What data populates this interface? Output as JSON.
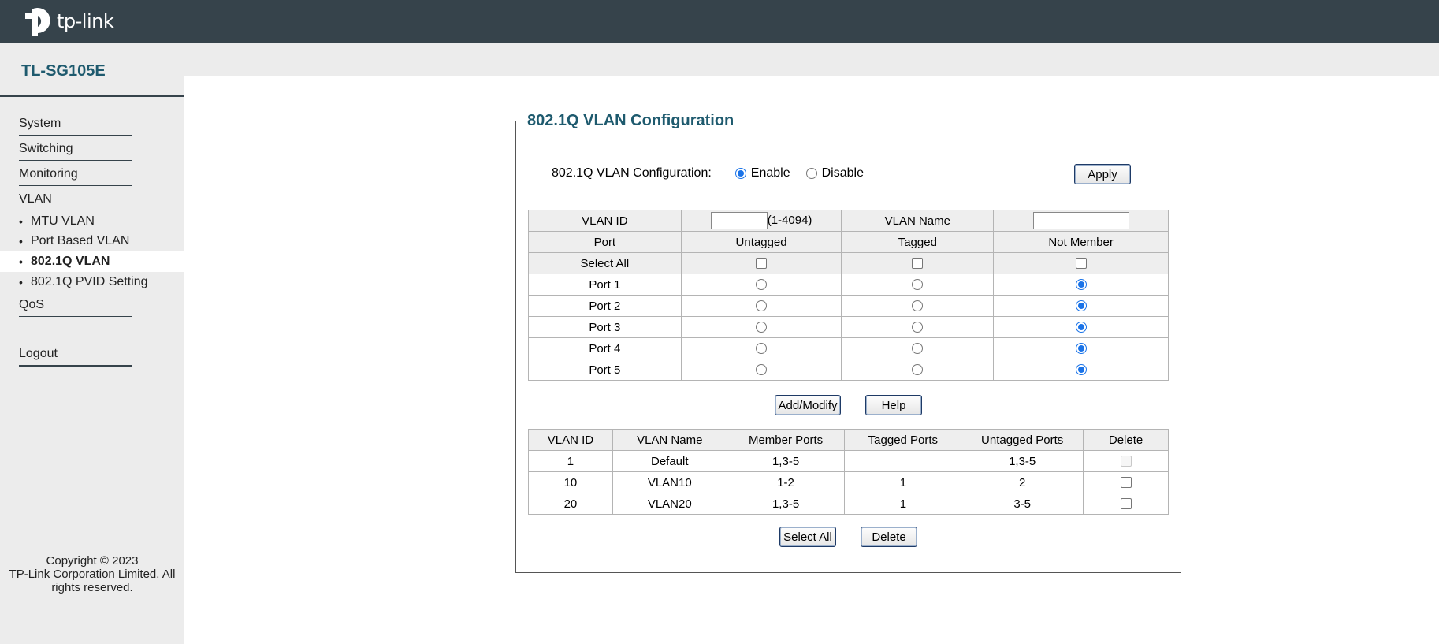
{
  "brand": {
    "logo_text": "tp-link",
    "model": "TL-SG105E"
  },
  "sidebar": {
    "system": "System",
    "switching": "Switching",
    "monitoring": "Monitoring",
    "vlan": "VLAN",
    "vlan_items": [
      "MTU VLAN",
      "Port Based VLAN",
      "802.1Q VLAN",
      "802.1Q PVID Setting"
    ],
    "active_item": "802.1Q VLAN",
    "qos": "QoS",
    "logout": "Logout",
    "copyright_line1": "Copyright © 2023",
    "copyright_line2": "TP-Link Corporation Limited. All",
    "copyright_line3": "rights reserved."
  },
  "panel": {
    "title": "802.1Q VLAN Configuration",
    "config_label": "802.1Q VLAN Configuration:",
    "enable_label": "Enable",
    "disable_label": "Disable",
    "selected_mode": "Enable",
    "apply_label": "Apply",
    "vlan_id_label": "VLAN ID",
    "vlan_id_value": "",
    "vlan_id_range": "(1-4094)",
    "vlan_name_label": "VLAN Name",
    "vlan_name_value": "",
    "port_header": "Port",
    "untagged_header": "Untagged",
    "tagged_header": "Tagged",
    "not_member_header": "Not Member",
    "select_all_label": "Select All",
    "ports": [
      {
        "name": "Port 1",
        "membership": "Not Member"
      },
      {
        "name": "Port 2",
        "membership": "Not Member"
      },
      {
        "name": "Port 3",
        "membership": "Not Member"
      },
      {
        "name": "Port 4",
        "membership": "Not Member"
      },
      {
        "name": "Port 5",
        "membership": "Not Member"
      }
    ],
    "add_modify_label": "Add/Modify",
    "help_label": "Help",
    "vlan_table": {
      "headers": [
        "VLAN ID",
        "VLAN Name",
        "Member Ports",
        "Tagged Ports",
        "Untagged Ports",
        "Delete"
      ],
      "rows": [
        {
          "id": "1",
          "name": "Default",
          "members": "1,3-5",
          "tagged": "",
          "untagged": "1,3-5",
          "delete_disabled": true
        },
        {
          "id": "10",
          "name": "VLAN10",
          "members": "1-2",
          "tagged": "1",
          "untagged": "2",
          "delete_disabled": false
        },
        {
          "id": "20",
          "name": "VLAN20",
          "members": "1,3-5",
          "tagged": "1",
          "untagged": "3-5",
          "delete_disabled": false
        }
      ]
    },
    "select_all_button": "Select All",
    "delete_button": "Delete"
  }
}
